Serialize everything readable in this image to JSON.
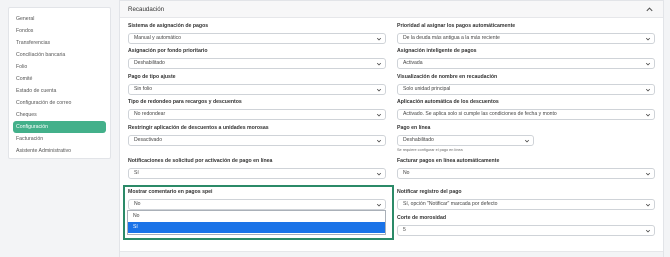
{
  "sidebar": {
    "items": [
      {
        "label": "General"
      },
      {
        "label": "Fondos"
      },
      {
        "label": "Transferencias"
      },
      {
        "label": "Conciliación bancaria"
      },
      {
        "label": "Folio"
      },
      {
        "label": "Comité"
      },
      {
        "label": "Estado de cuenta"
      },
      {
        "label": "Configuración de correo"
      },
      {
        "label": "Cheques"
      },
      {
        "label": "Configuración",
        "active": true
      },
      {
        "label": "Facturación"
      },
      {
        "label": "Asistente Administrativo"
      }
    ]
  },
  "panel": {
    "title": "Recaudación",
    "fields": {
      "f0": {
        "label": "Sistema de asignación de pagos",
        "value": "Manual y automático"
      },
      "f1": {
        "label": "Prioridad al asignar los pagos automáticamente",
        "value": "De la deuda más antigua a la más reciente"
      },
      "f2": {
        "label": "Asignación por fondo prioritario",
        "value": "Deshabilitado"
      },
      "f3": {
        "label": "Asignación inteligente de pagos",
        "value": "Activada"
      },
      "f4": {
        "label": "Pago de tipo ajuste",
        "value": "Sin folio"
      },
      "f5": {
        "label": "Visualización de nombre en recaudación",
        "value": "Solo unidad principal"
      },
      "f6": {
        "label": "Tipo de redondeo para recargos y descuentos",
        "value": "No redondear"
      },
      "f7": {
        "label": "Aplicación automática de los descuentos",
        "value": "Activado. Se aplica solo si cumple las condiciones de fecha y monto"
      },
      "f8": {
        "label": "Restringir aplicación de descuentos a unidades morosas",
        "value": "Desactivado"
      },
      "f9": {
        "label": "Pago en línea",
        "value": "Deshabilitado",
        "hint": "Se requiere configurar el pago en línea"
      },
      "f10": {
        "label": "Notificaciones de solicitud por activación de pago en línea",
        "value": "Sí"
      },
      "f11": {
        "label": "Facturar pagos en línea automáticamente",
        "value": "No"
      },
      "f12": {
        "label": "Mostrar comentario en pagos spei",
        "value": "No"
      },
      "f13": {
        "label": "Notificar registro del pago",
        "value": "Sí, opción \"Notificar\" marcada por defecto"
      },
      "f14": {
        "label": "Corte de morosidad",
        "value": "5"
      }
    },
    "dropdown": {
      "options": [
        {
          "label": "No"
        },
        {
          "label": "Sí",
          "selected": true
        }
      ]
    }
  },
  "colors": {
    "accent": "#43b08a",
    "highlight_border": "#2b8a68",
    "selected_option": "#1a73e8"
  }
}
